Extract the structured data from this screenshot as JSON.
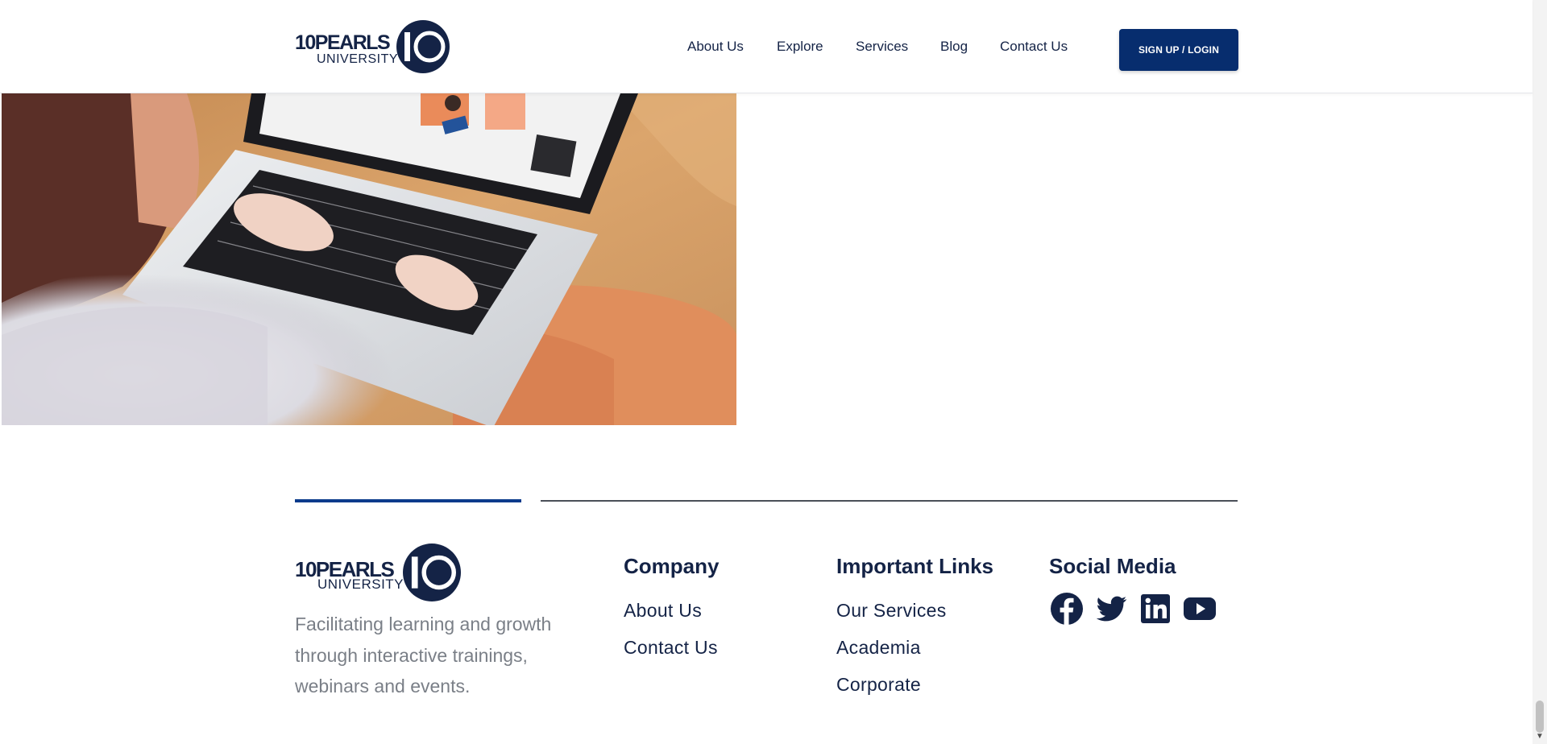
{
  "header": {
    "logo": {
      "brand": "10PEARLS",
      "sub": "UNIVERSITY"
    },
    "nav": [
      {
        "label": "About Us"
      },
      {
        "label": "Explore"
      },
      {
        "label": "Services"
      },
      {
        "label": "Blog"
      },
      {
        "label": "Contact Us"
      }
    ],
    "signup_label": "SIGN UP / LOGIN"
  },
  "hero": {
    "image": "person-typing-on-laptop-photo"
  },
  "footer": {
    "logo": {
      "brand": "10PEARLS",
      "sub": "UNIVERSITY"
    },
    "tagline": "Facilitating learning and growth through interactive trainings, webinars and events.",
    "company": {
      "title": "Company",
      "links": [
        {
          "label": "About Us"
        },
        {
          "label": "Contact Us"
        }
      ]
    },
    "important_links": {
      "title": "Important Links",
      "links": [
        {
          "label": "Our Services"
        },
        {
          "label": "Academia"
        },
        {
          "label": "Corporate"
        }
      ]
    },
    "social_media": {
      "title": "Social Media",
      "icons": [
        "facebook-icon",
        "twitter-icon",
        "linkedin-icon",
        "youtube-icon"
      ]
    }
  },
  "colors": {
    "brand_navy": "#142346",
    "button_blue": "#072d6e",
    "accent_blue": "#0b3b8c",
    "muted_text": "#7a7f87"
  }
}
